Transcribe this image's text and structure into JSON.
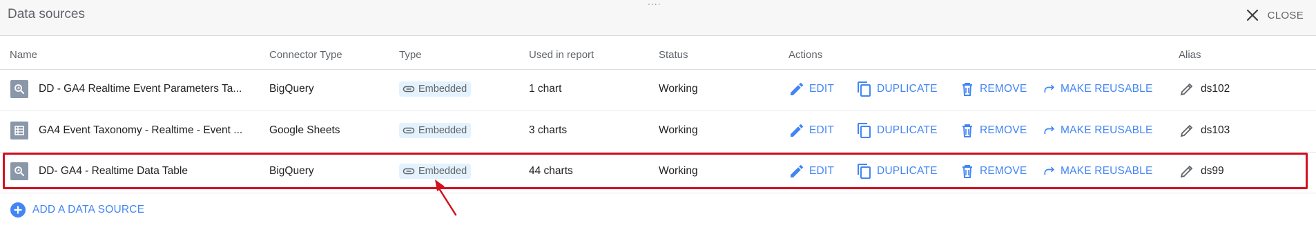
{
  "panel": {
    "title": "Data sources",
    "close_label": "CLOSE",
    "drag_handle": "....",
    "icons": {
      "close": "close-icon"
    }
  },
  "table": {
    "columns": [
      "Name",
      "Connector Type",
      "Type",
      "Used in report",
      "Status",
      "Actions",
      "Alias"
    ],
    "actions": {
      "edit": "EDIT",
      "duplicate": "DUPLICATE",
      "remove": "REMOVE",
      "make_reusable": "MAKE REUSABLE"
    },
    "rows": [
      {
        "icon": "bigquery-icon",
        "name": "DD - GA4 Realtime Event Parameters Ta...",
        "connector": "BigQuery",
        "type": "Embedded",
        "used": "1 chart",
        "status": "Working",
        "alias": "ds102"
      },
      {
        "icon": "sheets-icon",
        "name": "GA4 Event Taxonomy - Realtime - Event ...",
        "connector": "Google Sheets",
        "type": "Embedded",
        "used": "3 charts",
        "status": "Working",
        "alias": "ds103"
      },
      {
        "icon": "bigquery-icon",
        "name": "DD- GA4 - Realtime Data Table",
        "connector": "BigQuery",
        "type": "Embedded",
        "used": "44 charts",
        "status": "Working",
        "alias": "ds99"
      }
    ]
  },
  "footer": {
    "add_label": "ADD A DATA SOURCE"
  },
  "colors": {
    "accent": "#4285f4",
    "highlight": "#d3101e",
    "chip_bg": "#e3f2fd",
    "header_bg": "#f7f7f7"
  }
}
